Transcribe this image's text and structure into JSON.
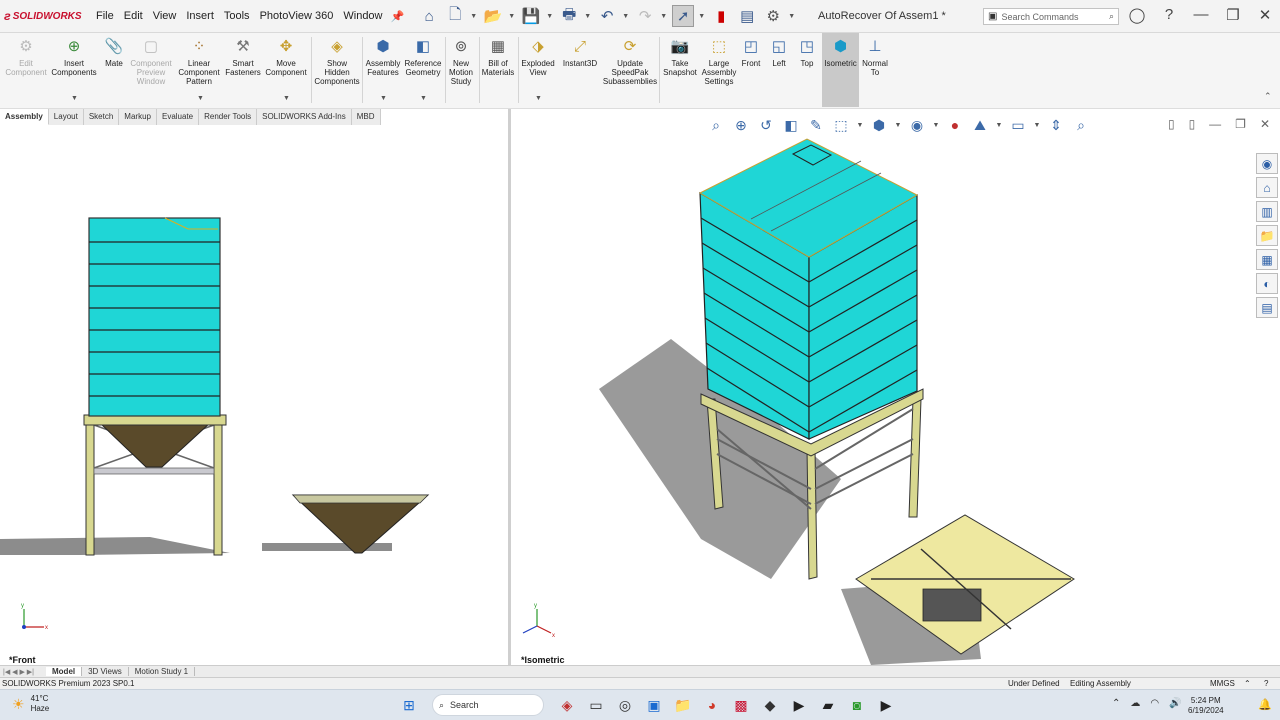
{
  "titlebar": {
    "brand": "SOLIDWORKS",
    "menu": [
      "File",
      "Edit",
      "View",
      "Insert",
      "Tools",
      "PhotoView 360",
      "Window"
    ],
    "document_title": "AutoRecover Of Assem1 *",
    "search_placeholder": "Search Commands"
  },
  "ribbon": {
    "edit_component": "Edit Component",
    "insert_components": "Insert Components",
    "mate": "Mate",
    "component_preview": "Component Preview Window",
    "linear_pattern": "Linear Component Pattern",
    "smart_fasteners": "Smart Fasteners",
    "move_component": "Move Component",
    "show_hidden": "Show Hidden Components",
    "assembly_features": "Assembly Features",
    "reference_geometry": "Reference Geometry",
    "new_motion_study": "New Motion Study",
    "bill_of_materials": "Bill of Materials",
    "exploded_view": "Exploded View",
    "instant3d": "Instant3D",
    "update_speedpak": "Update SpeedPak Subassemblies",
    "take_snapshot": "Take Snapshot",
    "large_assembly": "Large Assembly Settings",
    "front": "Front",
    "left": "Left",
    "top": "Top",
    "isometric": "Isometric",
    "normal_to": "Normal To"
  },
  "command_tabs": [
    "Assembly",
    "Layout",
    "Sketch",
    "Markup",
    "Evaluate",
    "Render Tools",
    "SOLIDWORKS Add-Ins",
    "MBD"
  ],
  "viewports": {
    "left_label": "*Front",
    "right_label": "*Isometric"
  },
  "bottom_tabs": [
    "Model",
    "3D Views",
    "Motion Study 1"
  ],
  "status": {
    "product": "SOLIDWORKS Premium 2023 SP0.1",
    "defined": "Under Defined",
    "mode": "Editing Assembly",
    "units": "MMGS"
  },
  "taskbar": {
    "temperature": "41°C",
    "condition": "Haze",
    "search": "Search",
    "time": "5:24 PM",
    "date": "6/19/2024"
  },
  "colors": {
    "tank": "#1fd6d6",
    "frame": "#d8d890",
    "hopper": "#5a4a2a",
    "brand": "#c8102e"
  }
}
